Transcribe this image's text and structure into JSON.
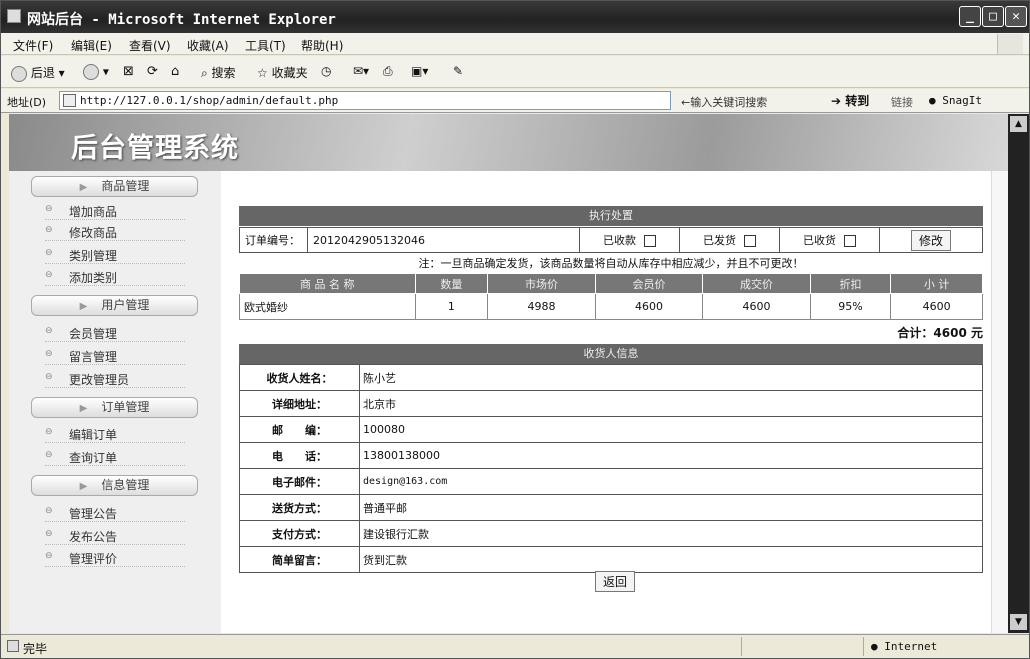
{
  "window": {
    "title": "网站后台 - Microsoft Internet Explorer"
  },
  "menu": [
    "文件(F)",
    "编辑(E)",
    "查看(V)",
    "收藏(A)",
    "工具(T)",
    "帮助(H)"
  ],
  "toolbar": {
    "back": "后退",
    "search": "搜索",
    "favorites": "收藏夹"
  },
  "address": {
    "label": "地址(D)",
    "url": "http://127.0.0.1/shop/admin/default.php",
    "keyword_hint": "←输入关键词搜索",
    "go": "转到",
    "links": "链接",
    "snagit": "SnagIt"
  },
  "banner": {
    "title": "后台管理系统"
  },
  "nav": [
    {
      "header": "商品管理",
      "items": [
        "增加商品",
        "修改商品",
        "类别管理",
        "添加类别"
      ]
    },
    {
      "header": "用户管理",
      "items": [
        "会员管理",
        "留言管理",
        "更改管理员"
      ]
    },
    {
      "header": "订单管理",
      "items": [
        "编辑订单",
        "查询订单"
      ]
    },
    {
      "header": "信息管理",
      "items": [
        "管理公告",
        "发布公告",
        "管理评价"
      ]
    }
  ],
  "order": {
    "section_title": "执行处置",
    "id_label": "订单编号：",
    "id": "2012042905132046",
    "paid_label": "已收款",
    "shipped_label": "已发货",
    "received_label": "已收货",
    "modify_button": "修改",
    "note": "注：一旦商品确定发货，该商品数量将自动从库存中相应减少，并且不可更改！"
  },
  "items_table": {
    "headers": [
      "商 品 名 称",
      "数量",
      "市场价",
      "会员价",
      "成交价",
      "折扣",
      "小 计"
    ],
    "rows": [
      [
        "欧式婚纱",
        "1",
        "4988",
        "4600",
        "4600",
        "95%",
        "4600"
      ]
    ],
    "total": "合计：4600 元"
  },
  "recipient": {
    "section_title": "收货人信息",
    "rows": [
      {
        "label": "收货人姓名：",
        "value": "陈小艺"
      },
      {
        "label": "详细地址：",
        "value": "北京市"
      },
      {
        "label": "邮　　编：",
        "value": "100080"
      },
      {
        "label": "电　　话：",
        "value": "13800138000"
      },
      {
        "label": "电子邮件：",
        "value": "design@163.com"
      },
      {
        "label": "送货方式：",
        "value": "普通平邮"
      },
      {
        "label": "支付方式：",
        "value": "建设银行汇款"
      },
      {
        "label": "简单留言：",
        "value": "货到汇款"
      }
    ]
  },
  "back_button": "返回",
  "status": {
    "text": "完毕",
    "zone": "Internet"
  }
}
